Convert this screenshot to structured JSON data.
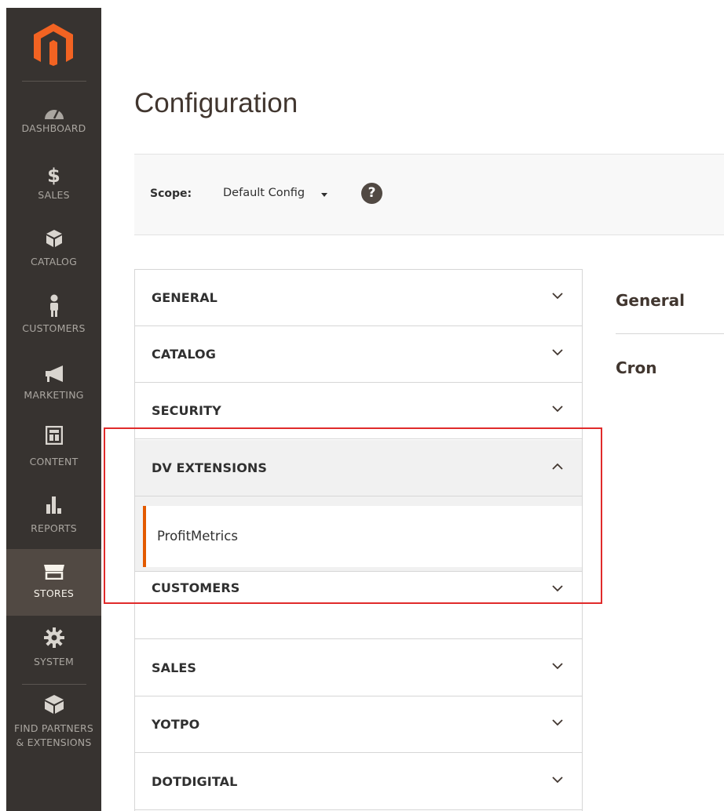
{
  "sidebar": {
    "logo": "magento-logo",
    "items": [
      {
        "label": "DASHBOARD",
        "icon": "dashboard-icon"
      },
      {
        "label": "SALES",
        "icon": "dollar-icon"
      },
      {
        "label": "CATALOG",
        "icon": "box-icon"
      },
      {
        "label": "CUSTOMERS",
        "icon": "person-icon"
      },
      {
        "label": "MARKETING",
        "icon": "megaphone-icon"
      },
      {
        "label": "CONTENT",
        "icon": "layout-icon"
      },
      {
        "label": "REPORTS",
        "icon": "bar-chart-icon"
      },
      {
        "label": "STORES",
        "icon": "storefront-icon",
        "active": true
      },
      {
        "label": "SYSTEM",
        "icon": "gear-icon"
      },
      {
        "label": "FIND PARTNERS & EXTENSIONS",
        "line1": "FIND PARTNERS",
        "line2": "& EXTENSIONS",
        "icon": "blocks-icon"
      }
    ]
  },
  "page": {
    "title": "Configuration"
  },
  "scope": {
    "label": "Scope:",
    "value": "Default Config",
    "help": "?"
  },
  "accordion": {
    "sections": [
      {
        "label": "GENERAL",
        "state": "collapsed"
      },
      {
        "label": "CATALOG",
        "state": "collapsed"
      },
      {
        "label": "SECURITY",
        "state": "collapsed"
      },
      {
        "label": "DV EXTENSIONS",
        "state": "expanded",
        "children": [
          "ProfitMetrics"
        ]
      },
      {
        "label": "CUSTOMERS",
        "state": "collapsed"
      },
      {
        "label": "SALES",
        "state": "collapsed"
      },
      {
        "label": "YOTPO",
        "state": "collapsed"
      },
      {
        "label": "DOTDIGITAL",
        "state": "collapsed"
      }
    ]
  },
  "content": {
    "sections": [
      "General",
      "Cron"
    ]
  },
  "colors": {
    "sidebar": "#373330",
    "active": "#514943",
    "accent": "#e35a00",
    "logo": "#f26322",
    "highlight": "#e02b2b"
  }
}
